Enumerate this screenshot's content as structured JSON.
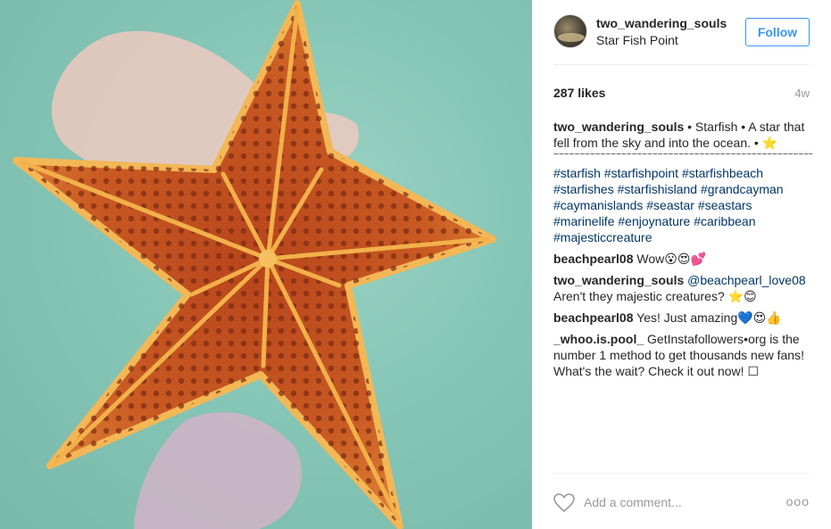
{
  "post": {
    "username": "two_wandering_souls",
    "location": "Star Fish Point",
    "follow_label": "Follow",
    "likes": "287 likes",
    "timestamp": "4w",
    "caption": {
      "user": "two_wandering_souls",
      "text": "• Starfish • A star that fell from the sky and into the ocean. • ⭐",
      "separator": "~~~~~~~~~~~~~~~~~~~~~~~~~~~~~~~~~~~~~~~~~~~~~~~~~~~~~~~~~~~~~~~~~~~~~~~~~~~~~",
      "hashtags": "#starfish #starfishpoint #starfishbeach #starfishes #starfishisland #grandcayman #caymanislands #seastar #seastars #marinelife #enjoynature #caribbean #majesticcreature"
    },
    "comments": [
      {
        "user": "beachpearl08",
        "mention": "",
        "text": "Wow😮😍💕"
      },
      {
        "user": "two_wandering_souls",
        "mention": "@beachpearl_love08",
        "text": " Aren't they majestic creatures? ⭐😊"
      },
      {
        "user": "beachpearl08",
        "mention": "",
        "text": "Yes! Just amazing💙😍👍"
      },
      {
        "user": "_whoo.is.pool_",
        "mention": "",
        "text": "GetInstafollowers•org is the number 1 method to get thousands new fans! What's the wait? Check it out now! ☐"
      }
    ],
    "add_comment_placeholder": "Add a comment...",
    "more_label": "ooo"
  },
  "icons": {
    "like": "heart-icon",
    "more": "more-options-icon"
  },
  "colors": {
    "follow": "#3897f0",
    "hashtag": "#003569",
    "muted": "#999999"
  }
}
